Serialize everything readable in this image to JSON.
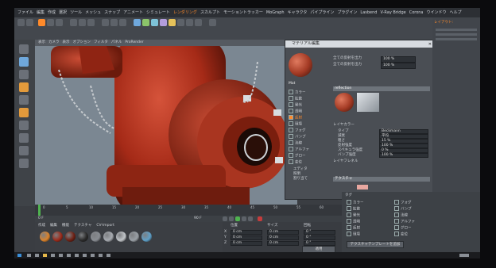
{
  "menubar": {
    "items": [
      "ファイル",
      "編集",
      "作成",
      "選択",
      "ツール",
      "メッシュ",
      "スナップ",
      "アニメート",
      "シミュレート",
      "レンダリング",
      "スカルプト",
      "モーショントラッカー",
      "MoGraph",
      "キャラクタ",
      "パイプライン",
      "プラグイン",
      "Lasbend",
      "V-Ray Bridge",
      "Corona",
      "ウインドウ",
      "ヘルプ"
    ],
    "highlight": "レンダリング",
    "layout_label": "レイアウト:"
  },
  "viewport": {
    "menu": [
      "表示",
      "カメラ",
      "表示",
      "オプション",
      "フィルタ",
      "パネル",
      "ProRender"
    ],
    "frame_info": "グリッド間隔: 10 cm"
  },
  "material_dialog": {
    "title": "マテリアル編集",
    "close": "✕",
    "channels": [
      {
        "label": "カラー",
        "checked": false
      },
      {
        "label": "拡散",
        "checked": false
      },
      {
        "label": "発光",
        "checked": false
      },
      {
        "label": "透明",
        "checked": false
      },
      {
        "label": "反射",
        "checked": true
      },
      {
        "label": "環境",
        "checked": false
      },
      {
        "label": "フォグ",
        "checked": false
      },
      {
        "label": "バンプ",
        "checked": false
      },
      {
        "label": "法線",
        "checked": false
      },
      {
        "label": "アルファ",
        "checked": false
      },
      {
        "label": "グロー",
        "checked": false
      },
      {
        "label": "変位",
        "checked": false
      }
    ],
    "side_links": [
      "エディタ",
      "照明",
      "割り当て"
    ],
    "mat_name": "Mat",
    "section": "reflection",
    "props": [
      {
        "label": "タイプ",
        "value": "Beckmann"
      },
      {
        "label": "減衰",
        "value": "平均"
      },
      {
        "label": "粗さ",
        "value": "15 %"
      },
      {
        "label": "反射強度",
        "value": "100 %"
      },
      {
        "label": "スペキュラ強度",
        "value": "0 %"
      },
      {
        "label": "バンプ強度",
        "value": "100 %"
      }
    ],
    "top_props": [
      {
        "label": "全ての反射を出力",
        "value": "100 %"
      },
      {
        "label": "全ての反射を出力",
        "value": "100 %"
      }
    ],
    "layer_label": "レイヤカラー",
    "layer_fresnel": "レイヤフレネル",
    "texture_label": "テクスチャ"
  },
  "timeline": {
    "ticks": [
      "0",
      "5",
      "10",
      "15",
      "20",
      "25",
      "30",
      "35",
      "40",
      "45",
      "50",
      "55",
      "60",
      "65",
      "70",
      "75",
      "80",
      "85",
      "90"
    ],
    "frame_start": "0 F",
    "frame_end": "90 F"
  },
  "material_manager": {
    "menu": [
      "作成",
      "編集",
      "機能",
      "テクスチャ",
      "CV-Import"
    ],
    "balls": [
      "#d9822b",
      "#9c2a1a",
      "#6e2013",
      "#2a2a2a",
      "#888c92",
      "#a6aab0",
      "#c0c4c8",
      "#9aa0a6",
      "#5fa0c8"
    ]
  },
  "coords": {
    "headers": [
      "位置",
      "サイズ",
      "回転"
    ],
    "rows": [
      {
        "axis": "X",
        "v1": "0 cm",
        "v2": "0 cm",
        "v3": "0 °"
      },
      {
        "axis": "Y",
        "v1": "0 cm",
        "v2": "0 cm",
        "v3": "0 °"
      },
      {
        "axis": "Z",
        "v1": "0 cm",
        "v2": "0 cm",
        "v3": "0 °"
      }
    ],
    "apply": "適用"
  },
  "attributes": {
    "title": "タグ",
    "rows": [
      "カラー",
      "拡散",
      "発光",
      "透明",
      "反射",
      "環境",
      "フォグ",
      "バンプ",
      "法線",
      "アルファ",
      "グロー",
      "変位"
    ],
    "button": "テクスチャテンプレートを追加"
  },
  "colors": {
    "accent": "#ff8a2a",
    "hydrant": "#b8311e"
  }
}
